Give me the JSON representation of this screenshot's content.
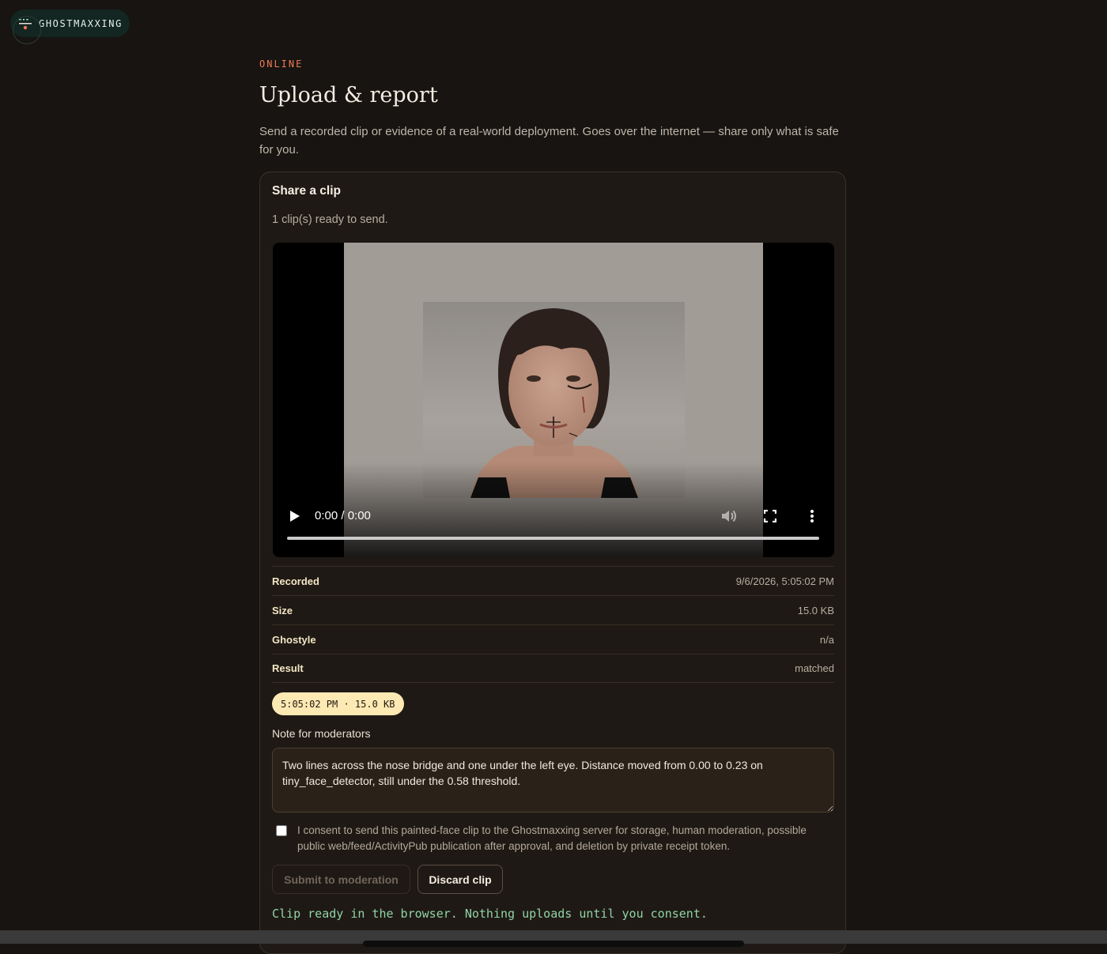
{
  "brand": {
    "name": "GHOSTMAXXING",
    "icon": "ghost-logo-icon"
  },
  "header": {
    "eyebrow": "ONLINE",
    "title": "Upload & report",
    "lede": "Send a recorded clip or evidence of a real-world deployment. Goes over the internet — share only what is safe for you."
  },
  "card": {
    "title": "Share a clip",
    "subtitle": "1 clip(s) ready to send."
  },
  "video": {
    "time": "0:00 / 0:00",
    "progress": 0,
    "icons": [
      "play-icon",
      "volume-icon",
      "fullscreen-icon",
      "more-vertical-icon"
    ]
  },
  "meta": [
    {
      "label": "Recorded",
      "value": "9/6/2026, 5:05:02 PM"
    },
    {
      "label": "Size",
      "value": "15.0 KB"
    },
    {
      "label": "Ghostyle",
      "value": "n/a"
    },
    {
      "label": "Result",
      "value": "matched"
    }
  ],
  "chip": "5:05:02 PM · 15.0 KB",
  "note": {
    "label": "Note for moderators",
    "value": "Two lines across the nose bridge and one under the left eye. Distance moved from 0.00 to 0.23 on tiny_face_detector, still under the 0.58 threshold."
  },
  "consent": {
    "checked": false,
    "text": "I consent to send this painted-face clip to the Ghostmaxxing server for storage, human moderation, possible public web/feed/ActivityPub publication after approval, and deletion by private receipt token."
  },
  "actions": {
    "submit_label": "Submit to moderation",
    "discard_label": "Discard clip"
  },
  "status": "Clip ready in the browser. Nothing uploads until you consent.",
  "colors": {
    "background": "#171411",
    "accent": "#ef7a55",
    "chip": "#fde9b3",
    "status": "#8fd4a5"
  }
}
